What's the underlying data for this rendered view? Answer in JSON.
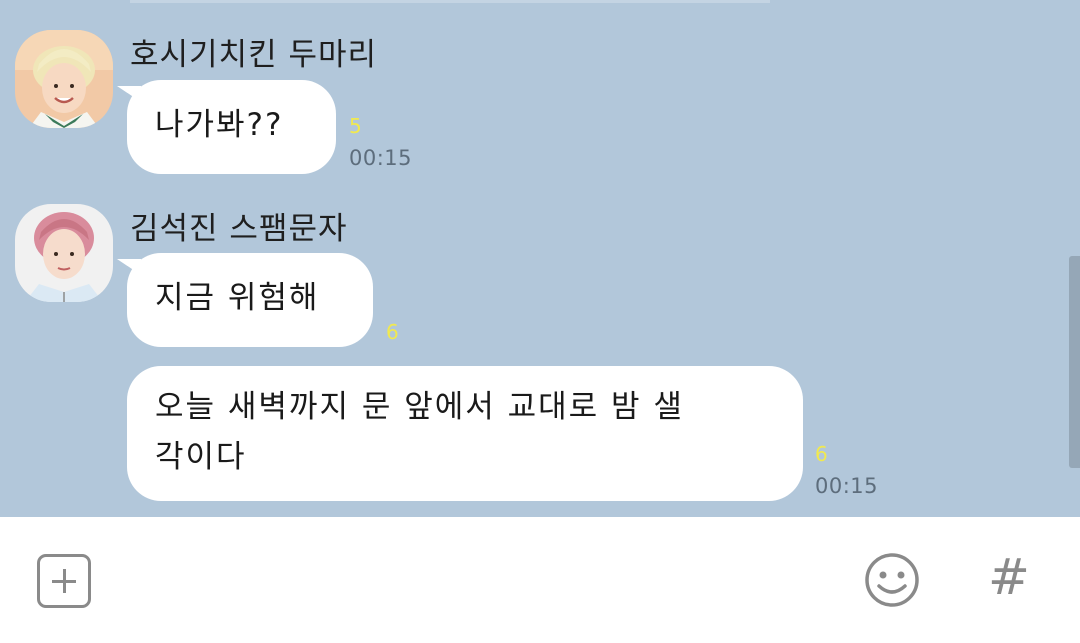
{
  "messages": [
    {
      "sender": "호시기치킨 두마리",
      "avatar": "avatar-blonde-boy-icon",
      "bubbles": [
        {
          "text": "나가봐??",
          "read_count": "5",
          "time": "00:15"
        }
      ]
    },
    {
      "sender": "김석진 스팸문자",
      "avatar": "avatar-pink-hair-boy-icon",
      "bubbles": [
        {
          "text": "지금 위험해",
          "read_count": "6",
          "time": ""
        },
        {
          "text_line1": "오늘 새벽까지 문 앞에서 교대로 밤 샐",
          "text_line2": "각이다",
          "read_count": "6",
          "time": "00:15"
        }
      ]
    }
  ],
  "input_bar": {
    "attach_icon": "plus-square-icon",
    "emoji_icon": "smiley-icon",
    "hash_label": "#"
  },
  "colors": {
    "chat_background": "#b2c7da",
    "bubble": "#ffffff",
    "read_count": "#f1e94f",
    "time": "#5d6d7c",
    "icon_gray": "#8a8a8a"
  }
}
